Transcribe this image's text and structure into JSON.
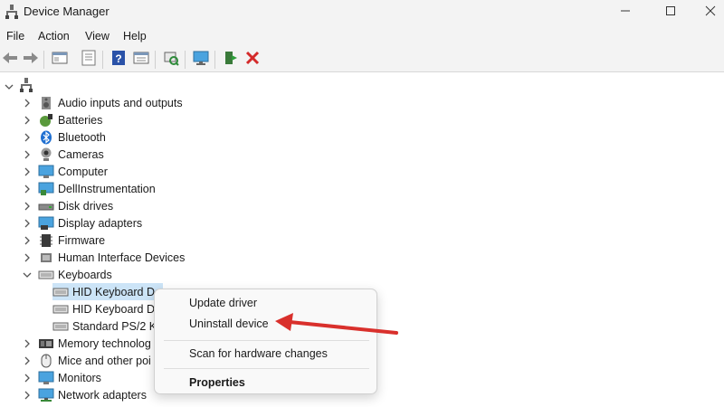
{
  "window": {
    "title": "Device Manager",
    "controls": {
      "minimize": "minimize-icon",
      "maximize": "maximize-icon",
      "close": "close-icon"
    }
  },
  "menu": [
    "File",
    "Action",
    "View",
    "Help"
  ],
  "toolbar": {
    "buttons": [
      "back-arrow-icon",
      "forward-arrow-icon",
      "properties-pane-icon",
      "list-view-icon",
      "help-icon",
      "details-view-icon",
      "scan-hardware-icon",
      "monitor-icon",
      "enable-device-icon",
      "uninstall-x-icon"
    ]
  },
  "tree": {
    "root_icon": "computer-tree-root-icon",
    "categories": [
      {
        "label": "Audio inputs and outputs",
        "icon": "speaker-icon",
        "expanded": false
      },
      {
        "label": "Batteries",
        "icon": "battery-icon",
        "expanded": false
      },
      {
        "label": "Bluetooth",
        "icon": "bluetooth-icon",
        "expanded": false
      },
      {
        "label": "Cameras",
        "icon": "camera-icon",
        "expanded": false
      },
      {
        "label": "Computer",
        "icon": "computer-icon",
        "expanded": false
      },
      {
        "label": "DellInstrumentation",
        "icon": "monitor-icon",
        "expanded": false
      },
      {
        "label": "Disk drives",
        "icon": "disk-drive-icon",
        "expanded": false
      },
      {
        "label": "Display adapters",
        "icon": "display-adapter-icon",
        "expanded": false
      },
      {
        "label": "Firmware",
        "icon": "firmware-icon",
        "expanded": false
      },
      {
        "label": "Human Interface Devices",
        "icon": "hid-icon",
        "expanded": false
      },
      {
        "label": "Keyboards",
        "icon": "keyboard-icon",
        "expanded": true
      },
      {
        "label": "Memory technolog",
        "icon": "memory-icon",
        "expanded": false
      },
      {
        "label": "Mice and other poi",
        "icon": "mouse-icon",
        "expanded": false
      },
      {
        "label": "Monitors",
        "icon": "monitor-icon",
        "expanded": false
      },
      {
        "label": "Network adapters",
        "icon": "network-icon",
        "expanded": false
      }
    ],
    "keyboard_children": [
      {
        "label": "HID Keyboard De",
        "selected": true
      },
      {
        "label": "HID Keyboard D",
        "selected": false
      },
      {
        "label": "Standard PS/2 K",
        "selected": false
      }
    ]
  },
  "context_menu": {
    "update_driver": "Update driver",
    "uninstall_device": "Uninstall device",
    "scan_hardware": "Scan for hardware changes",
    "properties": "Properties"
  },
  "colors": {
    "annotation_arrow": "#d9302c",
    "selection": "#cce4f7",
    "chrome": "#f3f3f3"
  }
}
